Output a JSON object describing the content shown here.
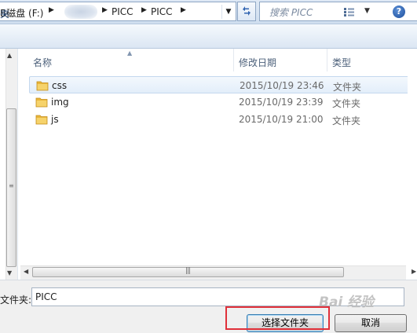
{
  "address_bar": {
    "drive_crumb": "B磁盘 (F:)",
    "crumbs": [
      "PICC",
      "PICC"
    ],
    "separator_glyph": "▶",
    "dropdown_glyph": "▼"
  },
  "search": {
    "placeholder": "搜索 PICC"
  },
  "toolbar": {
    "left_label": "夹"
  },
  "columns": {
    "name": "名称",
    "date": "修改日期",
    "type": "类型"
  },
  "rows": [
    {
      "name": "css",
      "date": "2015/10/19 23:46",
      "type": "文件夹",
      "selected": true
    },
    {
      "name": "img",
      "date": "2015/10/19 23:39",
      "type": "文件夹",
      "selected": false
    },
    {
      "name": "js",
      "date": "2015/10/19 21:00",
      "type": "文件夹",
      "selected": false
    }
  ],
  "bottom": {
    "folder_label": "文件夹:",
    "folder_value": "PICC",
    "select_button": "选择文件夹",
    "cancel_button": "取消",
    "watermark": "Bai 经验"
  },
  "colors": {
    "highlight": "#e0303a",
    "folder": "#e8b53a",
    "accent": "#3265b2"
  },
  "icons": [
    "refresh-icon",
    "search-icon",
    "views-icon",
    "help-icon",
    "folder-icon"
  ]
}
